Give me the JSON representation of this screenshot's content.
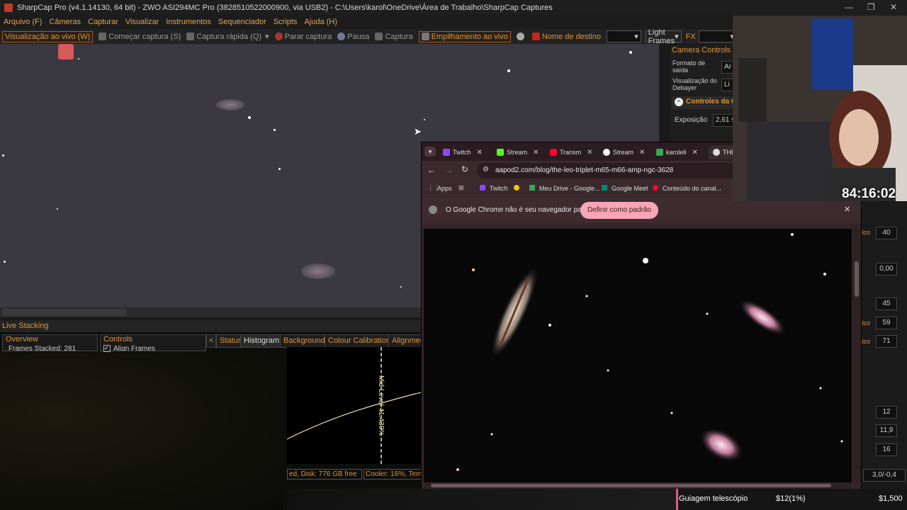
{
  "window": {
    "title": "SharpCap Pro (v4.1.14130, 64 bit) - ZWO ASI294MC Pro (3828510522000900, via USB2) - C:\\Users\\karol\\OneDrive\\Área de Trabalho\\SharpCap Captures"
  },
  "menu": [
    "Arquivo (F)",
    "Câmeras",
    "Capturar",
    "Visualizar",
    "Instrumentos",
    "Sequenciador",
    "Scripts",
    "Ajuda (H)"
  ],
  "toolbar": {
    "live_view": "Visualização ao vivo (W)",
    "start_capture": "Começar captura (S)",
    "quick_capture": "Captura rápida (Q)",
    "stop_capture": "Parar captura",
    "pause": "Pausa",
    "capture": "Captura",
    "live_stack": "Empilhamento ao vivo",
    "target_label": "Nome de destino",
    "target_value": "",
    "frame_type": "Light Frames",
    "fx_label": "FX",
    "fx_value": ""
  },
  "live_stacking": {
    "title": "Live Stacking",
    "overview": "Overview",
    "frames_stacked": "Frames Stacked:  281",
    "controls": "Controls",
    "align_frames": "Align Frames",
    "tabs": [
      "Status",
      "Histogram",
      "Background",
      "Colour Calibration",
      "Alignment"
    ],
    "active_tab": "Histogram",
    "mid_level": "Mid Level 41.430%",
    "disk_status": "ed, Disk: 776 GB free",
    "cooler_status": "Cooler: 16%, Tem"
  },
  "camera_controls": {
    "title": "Camera Controls",
    "output_format_label": "Formato de saída",
    "output_format_value": "Ar",
    "debayer_label": "Visualização do Debayer",
    "debayer_value": "Li",
    "section": "Controles da C",
    "exposure_label": "Exposição",
    "exposure_value": "2,61 s"
  },
  "right_values": [
    {
      "label": "tico",
      "value": "40"
    },
    {
      "label": "",
      "value": "0,00"
    },
    {
      "label": "",
      "value": "45"
    },
    {
      "label": "tico",
      "value": "59"
    },
    {
      "label": "tico",
      "value": "71"
    },
    {
      "label": "",
      "value": "12"
    },
    {
      "label": "",
      "value": "11,9"
    },
    {
      "label": "",
      "value": "16"
    },
    {
      "label": "",
      "value": "3,0/-0,4"
    }
  ],
  "browser": {
    "tabs": [
      {
        "label": "Twitch",
        "color": "#9146ff"
      },
      {
        "label": "Stream",
        "color": "#53fc18"
      },
      {
        "label": "Transm",
        "color": "#ff0033"
      },
      {
        "label": "Stream",
        "color": "#ffffff"
      },
      {
        "label": "karoleli",
        "color": "#34a853"
      },
      {
        "label": "THE L",
        "color": "#dddddd"
      }
    ],
    "url": "aapod2.com/blog/the-leo-triplet-m65-m66-amp-ngc-3628",
    "bookmarks": [
      "Apps",
      "Twitch",
      "Meu Drive - Google...",
      "Google Meet",
      "Conteúdo do canal..."
    ],
    "infobar_text": "O Google Chrome não é seu navegador padrão",
    "infobar_button": "Definir como padrão"
  },
  "stream": {
    "timer": "84:16:02",
    "bottom_label": "Guiagem telescópio",
    "bottom_progress": "$12(1%)",
    "bottom_goal": "$1,500"
  }
}
